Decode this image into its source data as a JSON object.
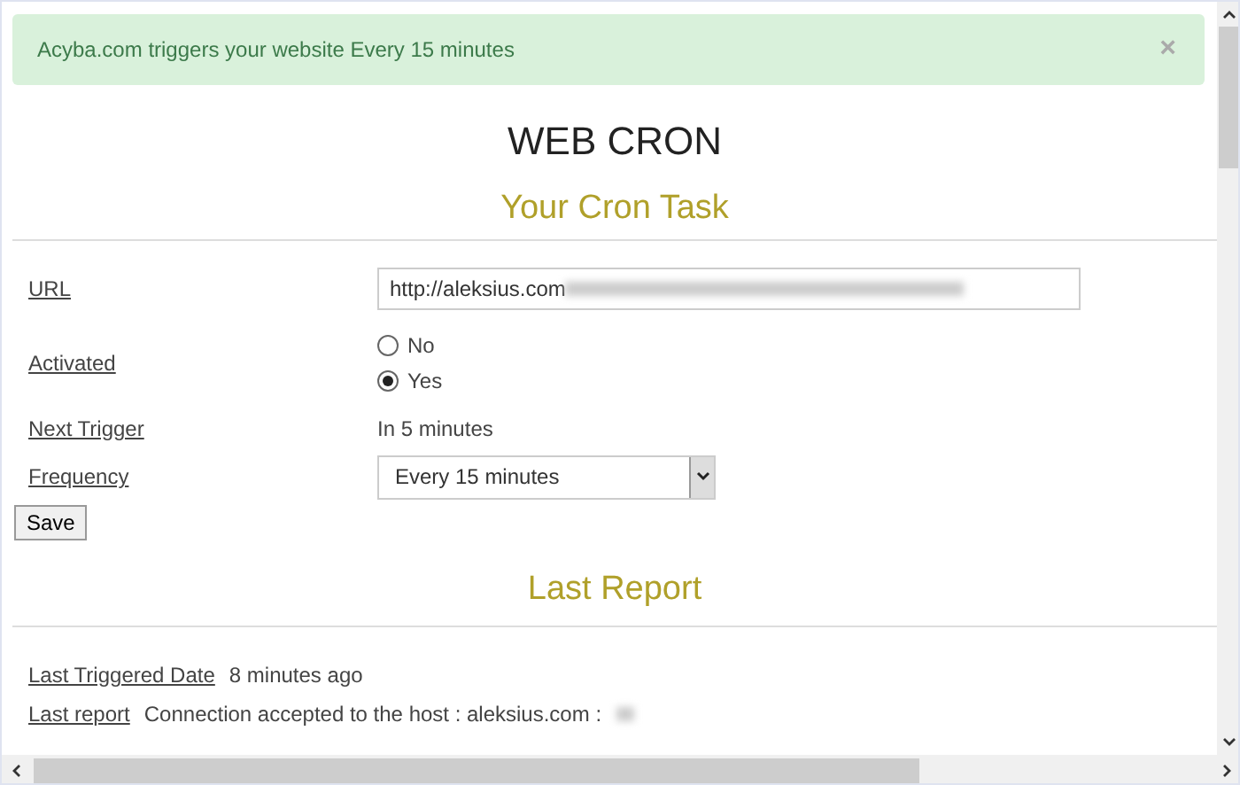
{
  "alert": {
    "message": "Acyba.com triggers your website Every 15 minutes",
    "close": "×"
  },
  "title": "WEB CRON",
  "task": {
    "heading": "Your Cron Task",
    "url": {
      "label": "URL",
      "value": "http://aleksius.com"
    },
    "activated": {
      "label": "Activated",
      "options": [
        {
          "label": "No",
          "selected": false
        },
        {
          "label": "Yes",
          "selected": true
        }
      ]
    },
    "next_trigger": {
      "label": "Next Trigger",
      "value": "In 5 minutes"
    },
    "frequency": {
      "label": "Frequency",
      "value": "Every 15 minutes"
    },
    "save": "Save"
  },
  "report": {
    "heading": "Last Report",
    "rows": [
      {
        "label": "Last Triggered Date",
        "value": "8 minutes ago"
      },
      {
        "label": "Last report",
        "value": "Connection accepted to the host : aleksius.com :"
      }
    ]
  }
}
